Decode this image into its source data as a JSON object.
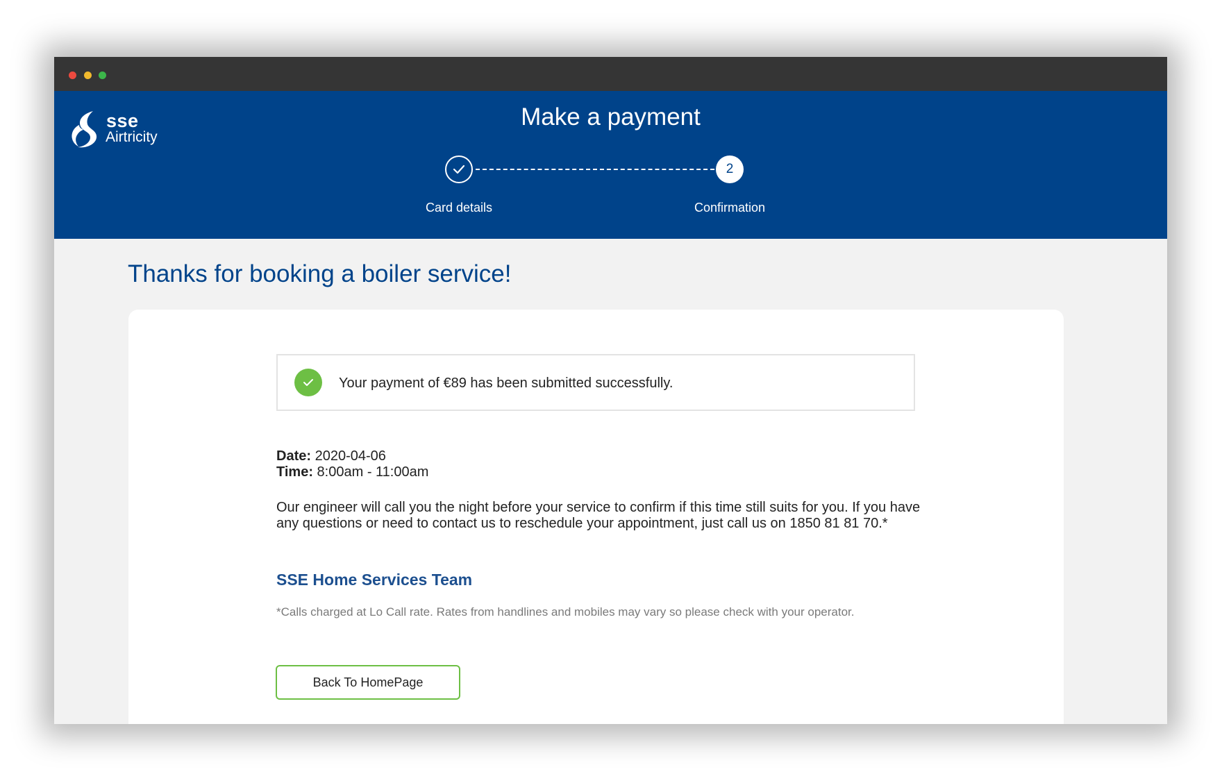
{
  "browser": {
    "colors": {
      "chrome": "#353535",
      "close": "#ec4a3f",
      "minimize": "#f1b92d",
      "maximize": "#3cb64a"
    }
  },
  "header": {
    "logo": {
      "line1": "sse",
      "line2": "Airtricity"
    },
    "title": "Make a payment",
    "background_color": "#00438a",
    "steps": [
      {
        "label": "Card details",
        "state": "completed",
        "icon": "check-icon"
      },
      {
        "label": "Confirmation",
        "state": "current",
        "number": "2"
      }
    ]
  },
  "main": {
    "heading": "Thanks for booking a boiler service!",
    "success_message": {
      "icon": "check-circle-icon",
      "text": "Your payment of €89 has been submitted successfully.",
      "icon_color": "#6dbf44"
    },
    "booking": {
      "date_label": "Date:",
      "date_value": "2020-04-06",
      "time_label": "Time:",
      "time_value": "8:00am - 11:00am"
    },
    "info_text": "Our engineer will call you the night before your service to confirm if this time still suits for you. If you have any questions or need to contact us to reschedule your appointment, just call us on 1850 81 81 70.*",
    "team_name": "SSE Home Services Team",
    "footnote": "*Calls charged at Lo Call rate. Rates from handlines and mobiles may vary so please check with your operator.",
    "back_button_label": "Back To HomePage"
  }
}
